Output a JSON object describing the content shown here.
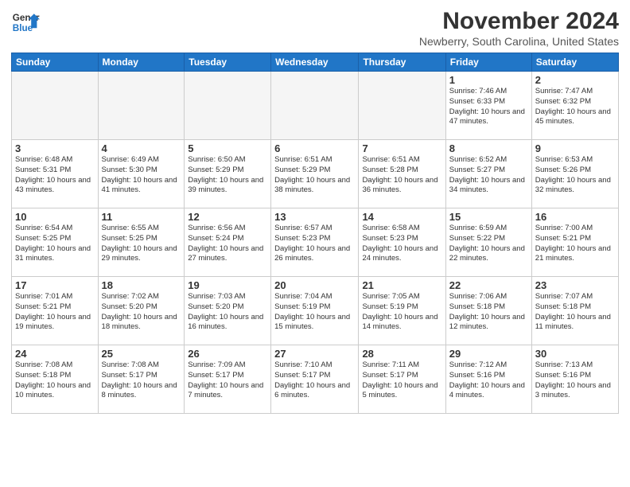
{
  "logo": {
    "line1": "General",
    "line2": "Blue"
  },
  "title": "November 2024",
  "subtitle": "Newberry, South Carolina, United States",
  "days_of_week": [
    "Sunday",
    "Monday",
    "Tuesday",
    "Wednesday",
    "Thursday",
    "Friday",
    "Saturday"
  ],
  "weeks": [
    [
      {
        "day": "",
        "empty": true
      },
      {
        "day": "",
        "empty": true
      },
      {
        "day": "",
        "empty": true
      },
      {
        "day": "",
        "empty": true
      },
      {
        "day": "",
        "empty": true
      },
      {
        "day": "1",
        "sunrise": "7:46 AM",
        "sunset": "6:33 PM",
        "daylight": "10 hours and 47 minutes."
      },
      {
        "day": "2",
        "sunrise": "7:47 AM",
        "sunset": "6:32 PM",
        "daylight": "10 hours and 45 minutes."
      }
    ],
    [
      {
        "day": "3",
        "sunrise": "6:48 AM",
        "sunset": "5:31 PM",
        "daylight": "10 hours and 43 minutes."
      },
      {
        "day": "4",
        "sunrise": "6:49 AM",
        "sunset": "5:30 PM",
        "daylight": "10 hours and 41 minutes."
      },
      {
        "day": "5",
        "sunrise": "6:50 AM",
        "sunset": "5:29 PM",
        "daylight": "10 hours and 39 minutes."
      },
      {
        "day": "6",
        "sunrise": "6:51 AM",
        "sunset": "5:29 PM",
        "daylight": "10 hours and 38 minutes."
      },
      {
        "day": "7",
        "sunrise": "6:51 AM",
        "sunset": "5:28 PM",
        "daylight": "10 hours and 36 minutes."
      },
      {
        "day": "8",
        "sunrise": "6:52 AM",
        "sunset": "5:27 PM",
        "daylight": "10 hours and 34 minutes."
      },
      {
        "day": "9",
        "sunrise": "6:53 AM",
        "sunset": "5:26 PM",
        "daylight": "10 hours and 32 minutes."
      }
    ],
    [
      {
        "day": "10",
        "sunrise": "6:54 AM",
        "sunset": "5:25 PM",
        "daylight": "10 hours and 31 minutes."
      },
      {
        "day": "11",
        "sunrise": "6:55 AM",
        "sunset": "5:25 PM",
        "daylight": "10 hours and 29 minutes."
      },
      {
        "day": "12",
        "sunrise": "6:56 AM",
        "sunset": "5:24 PM",
        "daylight": "10 hours and 27 minutes."
      },
      {
        "day": "13",
        "sunrise": "6:57 AM",
        "sunset": "5:23 PM",
        "daylight": "10 hours and 26 minutes."
      },
      {
        "day": "14",
        "sunrise": "6:58 AM",
        "sunset": "5:23 PM",
        "daylight": "10 hours and 24 minutes."
      },
      {
        "day": "15",
        "sunrise": "6:59 AM",
        "sunset": "5:22 PM",
        "daylight": "10 hours and 22 minutes."
      },
      {
        "day": "16",
        "sunrise": "7:00 AM",
        "sunset": "5:21 PM",
        "daylight": "10 hours and 21 minutes."
      }
    ],
    [
      {
        "day": "17",
        "sunrise": "7:01 AM",
        "sunset": "5:21 PM",
        "daylight": "10 hours and 19 minutes."
      },
      {
        "day": "18",
        "sunrise": "7:02 AM",
        "sunset": "5:20 PM",
        "daylight": "10 hours and 18 minutes."
      },
      {
        "day": "19",
        "sunrise": "7:03 AM",
        "sunset": "5:20 PM",
        "daylight": "10 hours and 16 minutes."
      },
      {
        "day": "20",
        "sunrise": "7:04 AM",
        "sunset": "5:19 PM",
        "daylight": "10 hours and 15 minutes."
      },
      {
        "day": "21",
        "sunrise": "7:05 AM",
        "sunset": "5:19 PM",
        "daylight": "10 hours and 14 minutes."
      },
      {
        "day": "22",
        "sunrise": "7:06 AM",
        "sunset": "5:18 PM",
        "daylight": "10 hours and 12 minutes."
      },
      {
        "day": "23",
        "sunrise": "7:07 AM",
        "sunset": "5:18 PM",
        "daylight": "10 hours and 11 minutes."
      }
    ],
    [
      {
        "day": "24",
        "sunrise": "7:08 AM",
        "sunset": "5:18 PM",
        "daylight": "10 hours and 10 minutes."
      },
      {
        "day": "25",
        "sunrise": "7:08 AM",
        "sunset": "5:17 PM",
        "daylight": "10 hours and 8 minutes."
      },
      {
        "day": "26",
        "sunrise": "7:09 AM",
        "sunset": "5:17 PM",
        "daylight": "10 hours and 7 minutes."
      },
      {
        "day": "27",
        "sunrise": "7:10 AM",
        "sunset": "5:17 PM",
        "daylight": "10 hours and 6 minutes."
      },
      {
        "day": "28",
        "sunrise": "7:11 AM",
        "sunset": "5:17 PM",
        "daylight": "10 hours and 5 minutes."
      },
      {
        "day": "29",
        "sunrise": "7:12 AM",
        "sunset": "5:16 PM",
        "daylight": "10 hours and 4 minutes."
      },
      {
        "day": "30",
        "sunrise": "7:13 AM",
        "sunset": "5:16 PM",
        "daylight": "10 hours and 3 minutes."
      }
    ]
  ]
}
